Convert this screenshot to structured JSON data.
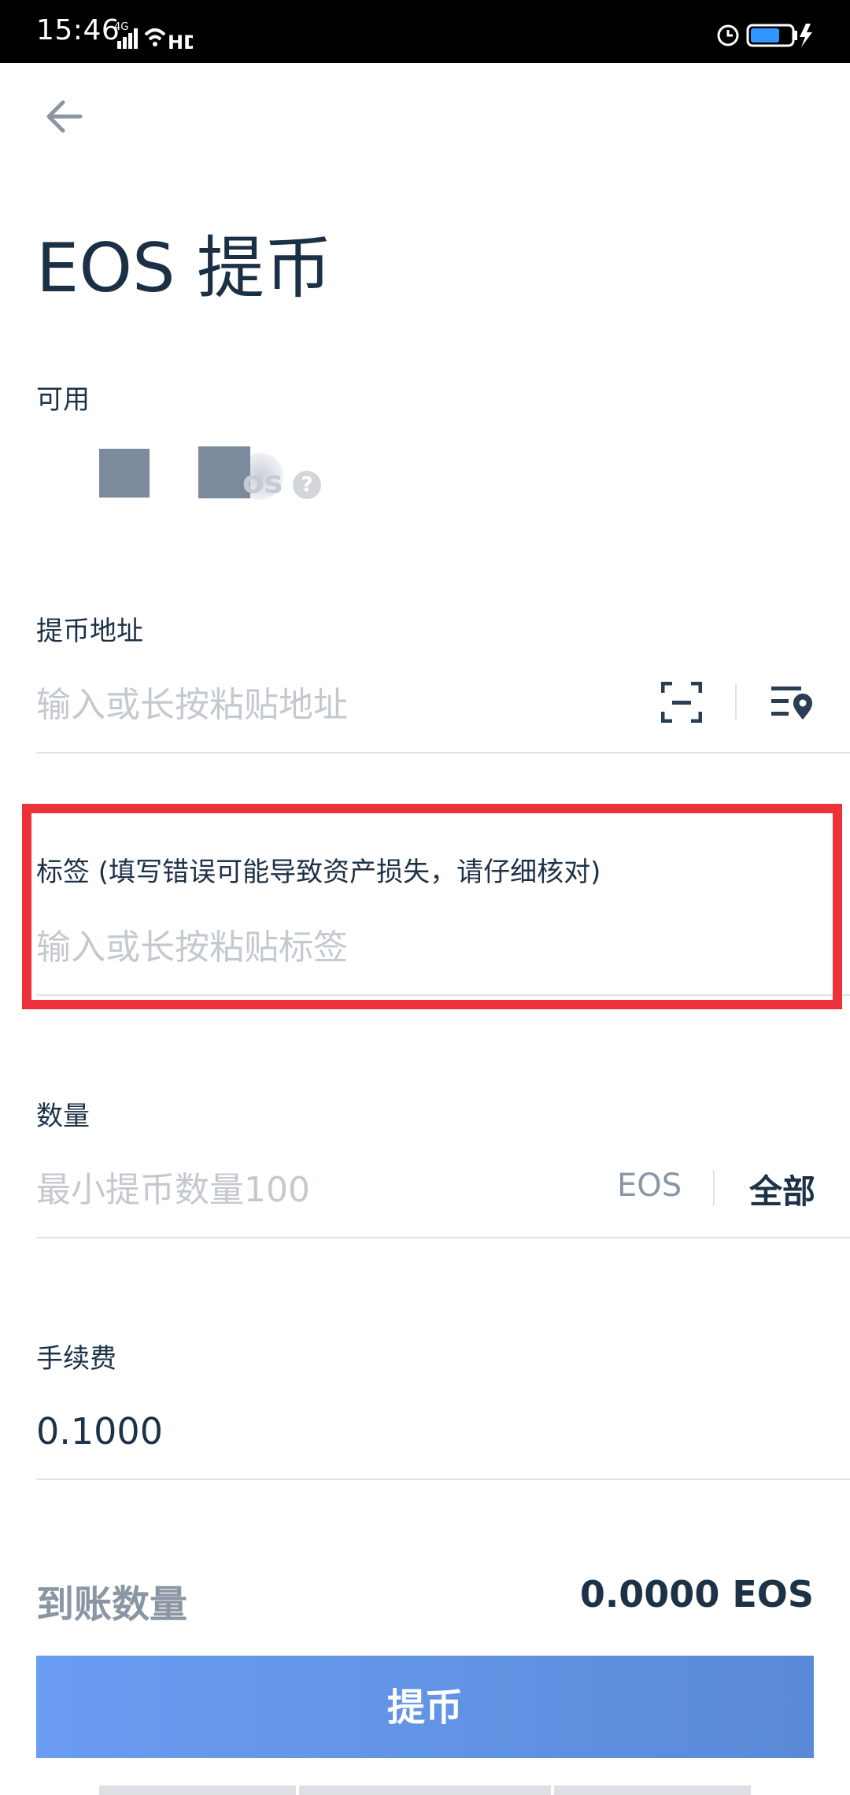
{
  "status_bar": {
    "time": "15:46",
    "network": "4G",
    "hd": "HD"
  },
  "header": {
    "title": "EOS 提币"
  },
  "available": {
    "label": "可用",
    "unit_partial": "os",
    "help": "?"
  },
  "address": {
    "label": "提币地址",
    "placeholder": "输入或长按粘贴地址",
    "icons": [
      "scan-icon",
      "address-book-icon"
    ]
  },
  "memo": {
    "label": "标签 (填写错误可能导致资产损失，请仔细核对)",
    "placeholder": "输入或长按粘贴标签"
  },
  "quantity": {
    "label": "数量",
    "placeholder": "最小提币数量100",
    "unit": "EOS",
    "all_label": "全部"
  },
  "fee": {
    "label": "手续费",
    "value": "0.1000"
  },
  "receive": {
    "label": "到账数量",
    "value": "0.0000 EOS"
  },
  "submit": {
    "label": "提币"
  },
  "colors": {
    "accent": "#6a9df2",
    "highlight": "#ec3238",
    "text": "#1d3247",
    "muted": "#8a96a3"
  }
}
